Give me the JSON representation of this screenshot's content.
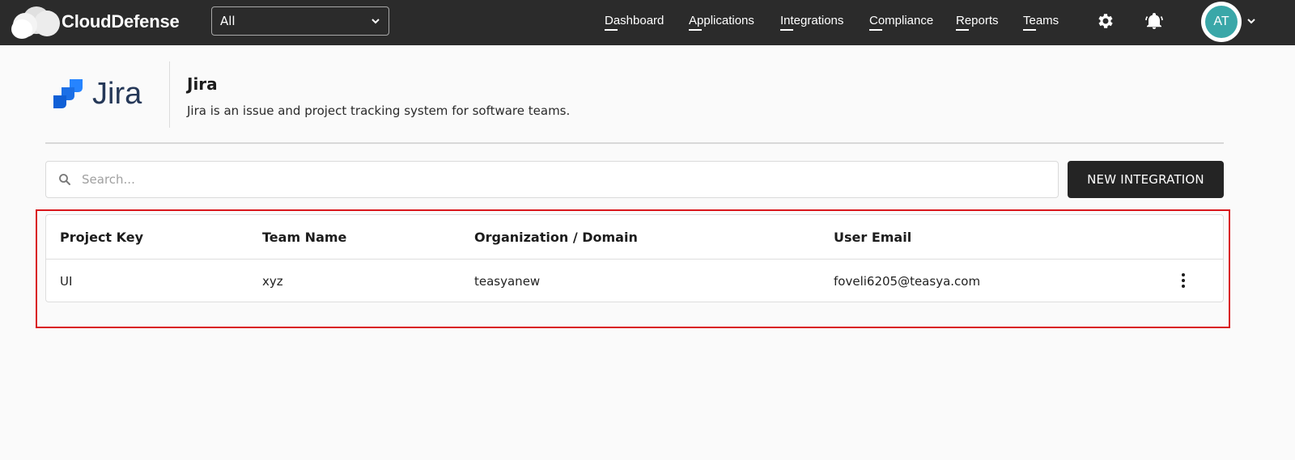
{
  "app": {
    "brand": "CloudDefense"
  },
  "scope_select": {
    "value": "All"
  },
  "nav": {
    "items": [
      {
        "label": "Dashboard"
      },
      {
        "label": "Applications"
      },
      {
        "label": "Integrations"
      },
      {
        "label": "Compliance"
      },
      {
        "label": "Reports"
      },
      {
        "label": "Teams"
      }
    ]
  },
  "icons": {
    "settings": "gear-icon",
    "alerts": "bell-icon",
    "search": "search-icon",
    "more": "more-vertical-icon"
  },
  "user": {
    "initials": "AT",
    "avatar_color": "#3aa7a8"
  },
  "integration": {
    "logo_text": "Jira",
    "title": "Jira",
    "description": "Jira is an issue and project tracking system for software teams."
  },
  "search": {
    "placeholder": "Search..."
  },
  "actions": {
    "new_integration": "NEW INTEGRATION"
  },
  "table": {
    "columns": [
      "Project Key",
      "Team Name",
      "Organization / Domain",
      "User Email"
    ],
    "rows": [
      {
        "project_key": "UI",
        "team_name": "xyz",
        "organization": "teasyanew",
        "user_email": "foveli6205@teasya.com"
      }
    ]
  },
  "colors": {
    "topbar": "#2b2b2b",
    "highlight": "#d9161b",
    "jira_blue": "#2684ff",
    "button": "#242424"
  }
}
